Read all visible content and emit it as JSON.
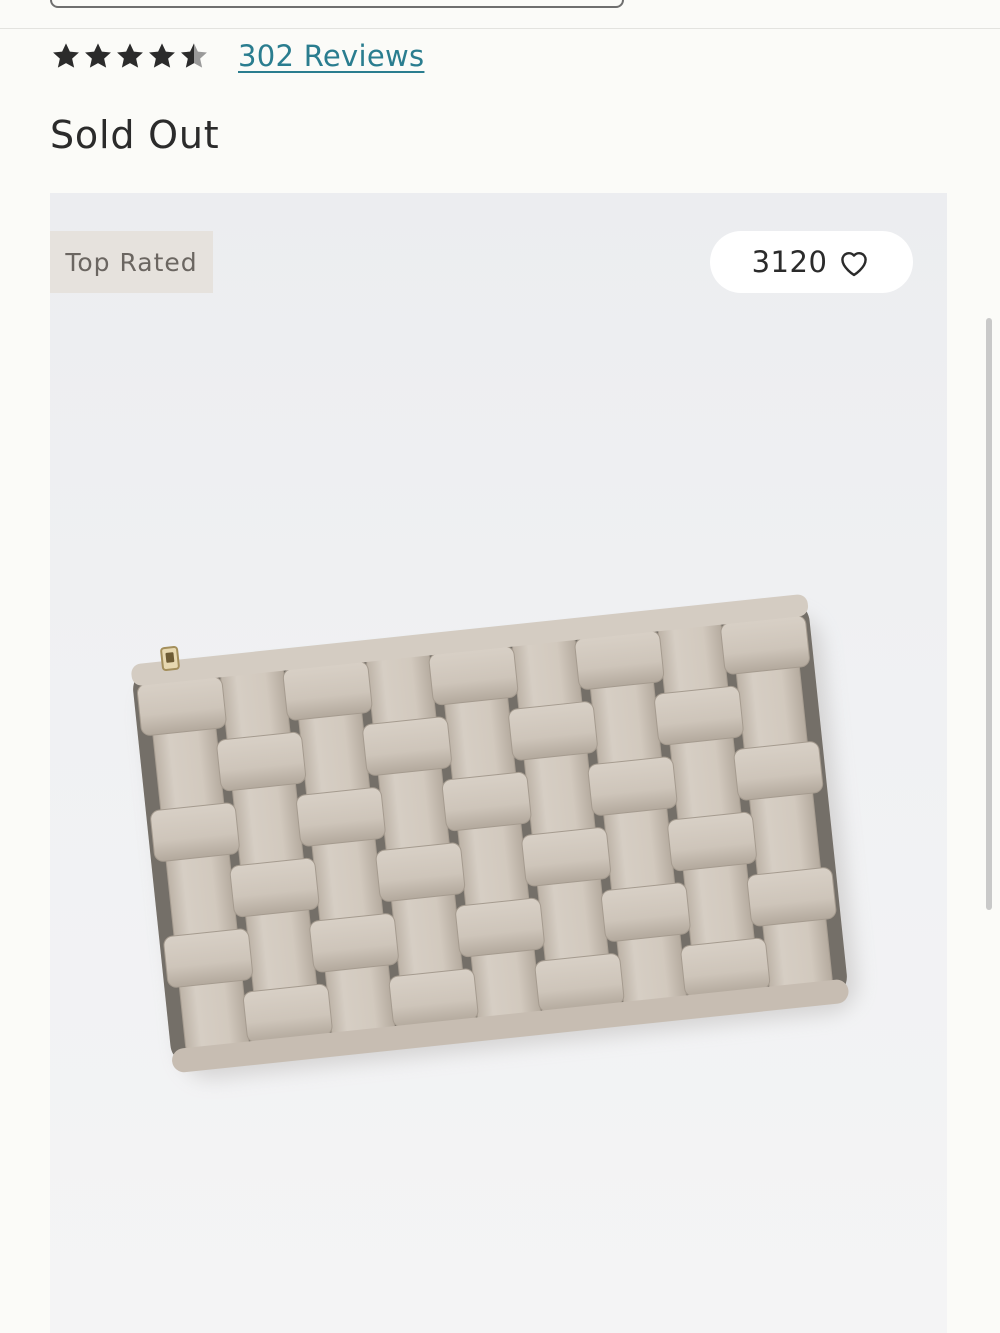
{
  "rating": {
    "stars": 4.5,
    "max_stars": 5,
    "reviews_link": "302 Reviews"
  },
  "status": {
    "availability": "Sold Out"
  },
  "product_image": {
    "badge": "Top Rated",
    "favorites_count": "3120",
    "product_icon": "woven-clutch-bag"
  },
  "colors": {
    "link": "#2a7d8f",
    "badge_bg": "#e6e2dd",
    "clutch": "#cfc6bb"
  }
}
